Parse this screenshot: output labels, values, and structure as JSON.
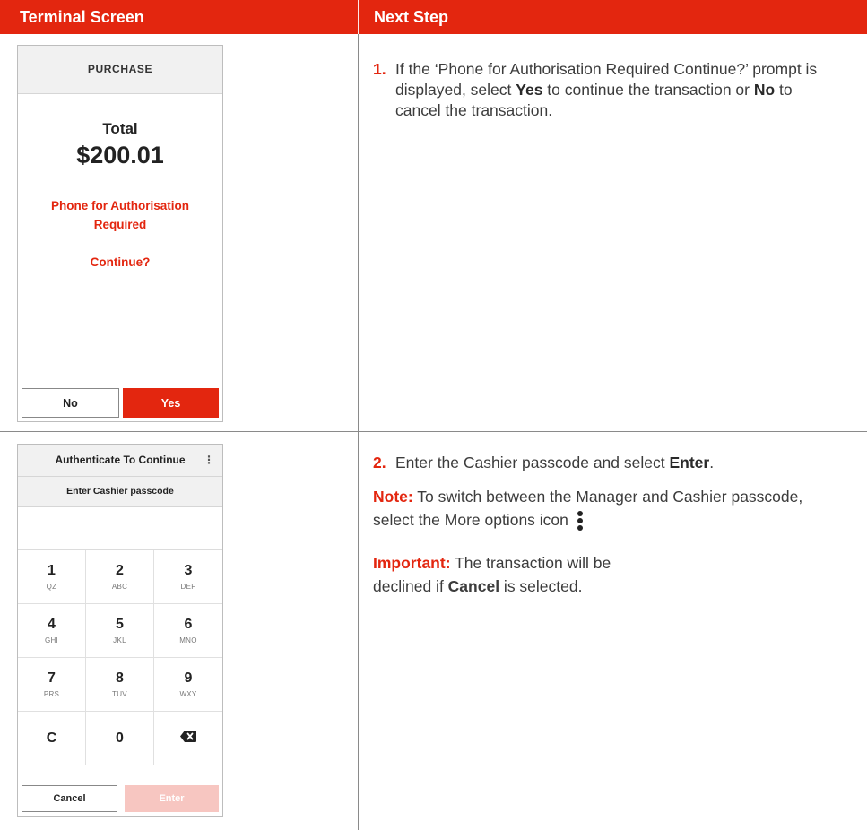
{
  "header": {
    "col_left": "Terminal Screen",
    "col_right": "Next Step"
  },
  "screen1": {
    "title": "PURCHASE",
    "total_label": "Total",
    "amount": "$200.01",
    "message_line1": "Phone for Authorisation",
    "message_line2": "Required",
    "continue": "Continue?",
    "no_button": "No",
    "yes_button": "Yes"
  },
  "screen2": {
    "title": "Authenticate To Continue",
    "kebab": "⋮",
    "subtitle": "Enter Cashier passcode",
    "keys": [
      {
        "digit": "1",
        "letters": "QZ"
      },
      {
        "digit": "2",
        "letters": "ABC"
      },
      {
        "digit": "3",
        "letters": "DEF"
      },
      {
        "digit": "4",
        "letters": "GHI"
      },
      {
        "digit": "5",
        "letters": "JKL"
      },
      {
        "digit": "6",
        "letters": "MNO"
      },
      {
        "digit": "7",
        "letters": "PRS"
      },
      {
        "digit": "8",
        "letters": "TUV"
      },
      {
        "digit": "9",
        "letters": "WXY"
      },
      {
        "digit": "C",
        "letters": ""
      },
      {
        "digit": "0",
        "letters": ""
      },
      {
        "digit": "⌫",
        "letters": ""
      }
    ],
    "cancel_button": "Cancel",
    "enter_button": "Enter"
  },
  "step1": {
    "number": "1.",
    "text_a": "If the ‘Phone for Authorisation Required Continue?’ prompt is displayed, select ",
    "yes": "Yes",
    "text_b": " to continue the transaction or ",
    "no": "No",
    "text_c": " to cancel the transaction."
  },
  "step2": {
    "number": "2.",
    "text_a": "Enter the Cashier passcode and select ",
    "enter": "Enter",
    "text_b": "."
  },
  "note": {
    "label": "Note:",
    "text": " To switch between the Manager and Cashier passcode, select the More options icon "
  },
  "important": {
    "label": "Important:",
    "text_a": " The transaction will be declined if ",
    "cancel": "Cancel",
    "text_b": " is selected."
  },
  "colors": {
    "accent": "#e3260f",
    "disabled_button": "#f7c6c1"
  }
}
